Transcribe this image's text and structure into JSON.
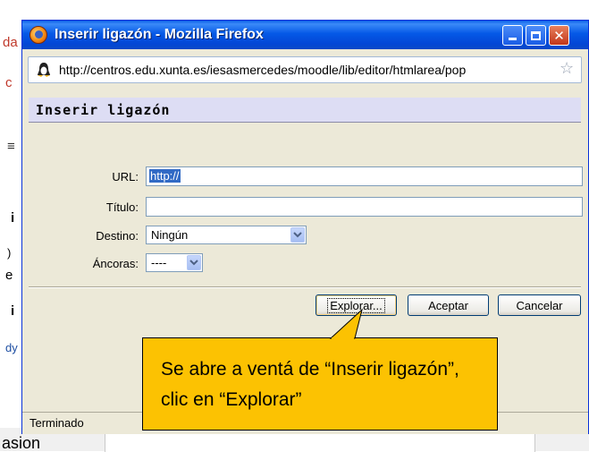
{
  "background": {
    "fragments": [
      "da",
      "c",
      "≡",
      "i",
      ")",
      "e",
      "i",
      "dy",
      "asion"
    ]
  },
  "window": {
    "title": "Inserir ligazón - Mozilla Firefox",
    "icon": "firefox-icon",
    "controls": [
      "minimize",
      "maximize",
      "close"
    ]
  },
  "address_bar": {
    "url": "http://centros.edu.xunta.es/iesasmercedes/moodle/lib/editor/htmlarea/pop",
    "site_icon": "linux-penguin-icon",
    "bookmark_icon": "star-icon"
  },
  "dialog": {
    "heading": "Inserir ligazón",
    "fields": {
      "url_label": "URL:",
      "url_value": "http://",
      "title_label": "Título:",
      "title_value": "",
      "target_label": "Destino:",
      "target_value": "Ningún",
      "anchors_label": "Áncoras:",
      "anchors_value": "----"
    },
    "buttons": {
      "browse": "Explorar...",
      "ok": "Aceptar",
      "cancel": "Cancelar"
    }
  },
  "statusbar": {
    "text": "Terminado"
  },
  "callout": {
    "text": "Se abre a ventá de “Inserir ligazón”, clic en “Explorar”",
    "color": "#fcc202"
  },
  "colors": {
    "titlebar": "#0559e7",
    "callout_fill": "#fcc202",
    "dialog_heading": "#ddddf4",
    "window_face": "#ece9d8"
  }
}
